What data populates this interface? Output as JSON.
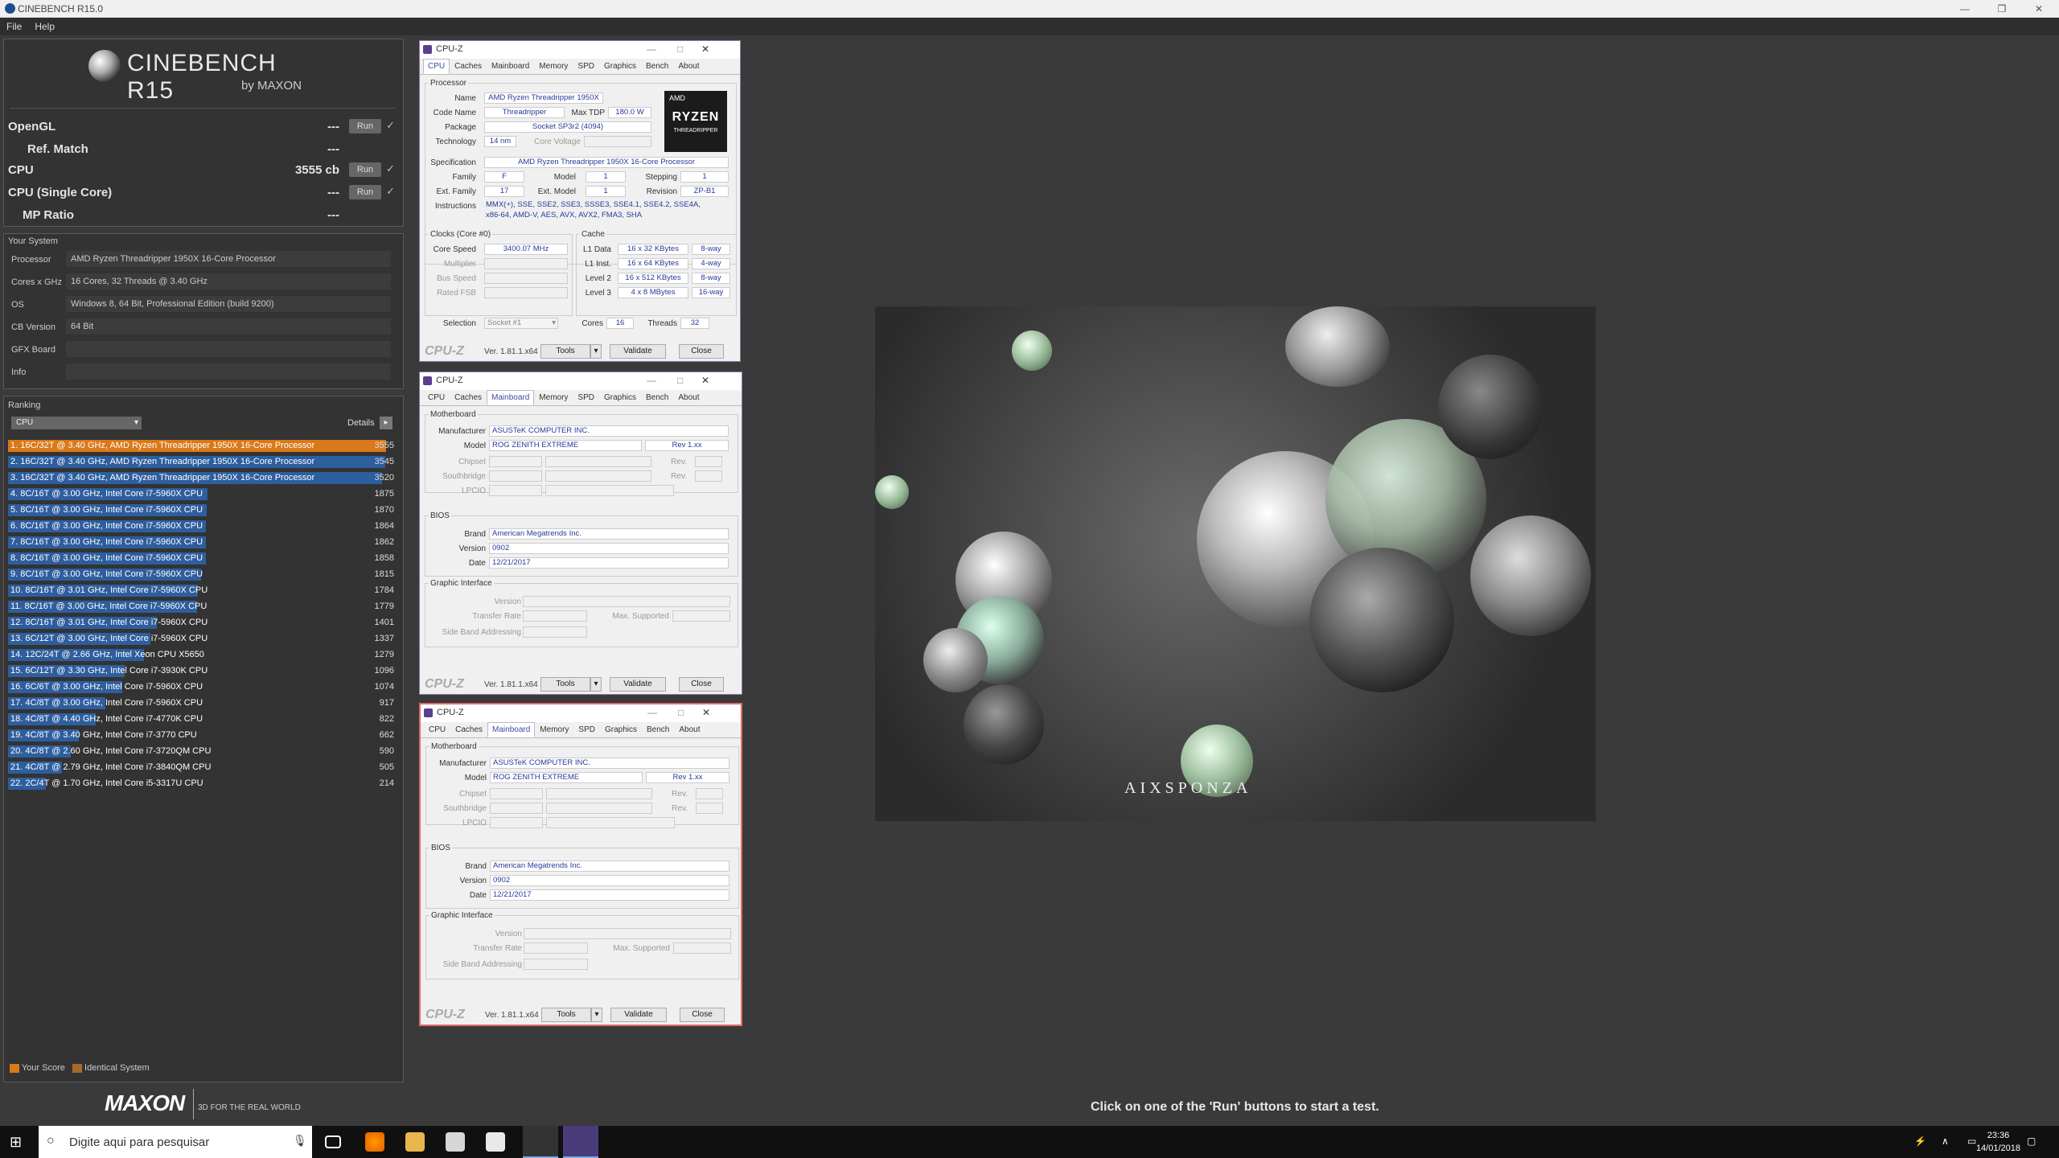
{
  "window": {
    "title": "CINEBENCH R15.0"
  },
  "menu": [
    "File",
    "Help"
  ],
  "cinebench": {
    "logo_name": "CINEBENCH R15",
    "logo_by": "by MAXON",
    "run_label": "Run",
    "benchmarks": [
      {
        "label": "OpenGL",
        "value": "---",
        "has_run": true
      },
      {
        "label": "Ref. Match",
        "value": "---",
        "has_run": false
      },
      {
        "label": "CPU",
        "value": "3555 cb",
        "has_run": true
      },
      {
        "label": "CPU (Single Core)",
        "value": "---",
        "has_run": true
      },
      {
        "label": "MP Ratio",
        "value": "---",
        "has_run": false
      }
    ],
    "your_system_title": "Your System",
    "system": [
      {
        "key": "Processor",
        "value": "AMD Ryzen Threadripper 1950X 16-Core Processor"
      },
      {
        "key": "Cores x GHz",
        "value": "16 Cores, 32 Threads @ 3.40 GHz"
      },
      {
        "key": "OS",
        "value": "Windows 8, 64 Bit, Professional Edition (build 9200)"
      },
      {
        "key": "CB Version",
        "value": "64 Bit"
      },
      {
        "key": "GFX Board",
        "value": ""
      },
      {
        "key": "Info",
        "value": ""
      }
    ],
    "ranking_title": "Ranking",
    "ranking_select": "CPU",
    "details_label": "Details",
    "ranking": [
      {
        "text": "1. 16C/32T @ 3.40 GHz, AMD Ryzen Threadripper 1950X 16-Core Processor",
        "score": 3555,
        "color": "#d9791a"
      },
      {
        "text": "2. 16C/32T @ 3.40 GHz, AMD Ryzen Threadripper 1950X 16-Core Processor",
        "score": 3545,
        "color": "#2d5e9e"
      },
      {
        "text": "3. 16C/32T @ 3.40 GHz, AMD Ryzen Threadripper 1950X 16-Core Processor",
        "score": 3520,
        "color": "#2d5e9e"
      },
      {
        "text": "4. 8C/16T @ 3.00 GHz, Intel Core i7-5960X CPU",
        "score": 1875,
        "color": "#2d5e9e"
      },
      {
        "text": "5. 8C/16T @ 3.00 GHz, Intel Core i7-5960X CPU",
        "score": 1870,
        "color": "#2d5e9e"
      },
      {
        "text": "6. 8C/16T @ 3.00 GHz, Intel Core i7-5960X CPU",
        "score": 1864,
        "color": "#2d5e9e"
      },
      {
        "text": "7. 8C/16T @ 3.00 GHz, Intel Core i7-5960X CPU",
        "score": 1862,
        "color": "#2d5e9e"
      },
      {
        "text": "8. 8C/16T @ 3.00 GHz, Intel Core i7-5960X CPU",
        "score": 1858,
        "color": "#2d5e9e"
      },
      {
        "text": "9. 8C/16T @ 3.00 GHz, Intel Core i7-5960X CPU",
        "score": 1815,
        "color": "#2d5e9e"
      },
      {
        "text": "10. 8C/16T @ 3.01 GHz, Intel Core i7-5960X CPU",
        "score": 1784,
        "color": "#2d5e9e"
      },
      {
        "text": "11. 8C/16T @ 3.00 GHz, Intel Core i7-5960X CPU",
        "score": 1779,
        "color": "#2d5e9e"
      },
      {
        "text": "12. 8C/16T @ 3.01 GHz, Intel Core i7-5960X CPU",
        "score": 1401,
        "color": "#2d5e9e"
      },
      {
        "text": "13. 6C/12T @ 3.00 GHz, Intel Core i7-5960X CPU",
        "score": 1337,
        "color": "#2d5e9e"
      },
      {
        "text": "14. 12C/24T @ 2.66 GHz, Intel Xeon CPU X5650",
        "score": 1279,
        "color": "#2d5e9e"
      },
      {
        "text": "15. 6C/12T @ 3.30 GHz,  Intel Core i7-3930K CPU",
        "score": 1096,
        "color": "#2d5e9e"
      },
      {
        "text": "16. 6C/6T @ 3.00 GHz, Intel Core i7-5960X CPU",
        "score": 1074,
        "color": "#2d5e9e"
      },
      {
        "text": "17. 4C/8T @ 3.00 GHz, Intel Core i7-5960X CPU",
        "score": 917,
        "color": "#2d5e9e"
      },
      {
        "text": "18. 4C/8T @ 4.40 GHz, Intel Core i7-4770K CPU",
        "score": 822,
        "color": "#2d5e9e"
      },
      {
        "text": "19. 4C/8T @ 3.40 GHz,  Intel Core i7-3770 CPU",
        "score": 662,
        "color": "#2d5e9e"
      },
      {
        "text": "20. 4C/8T @ 2.60 GHz, Intel Core i7-3720QM CPU",
        "score": 590,
        "color": "#2d5e9e"
      },
      {
        "text": "21. 4C/8T @ 2.79 GHz,  Intel Core i7-3840QM CPU",
        "score": 505,
        "color": "#2d5e9e"
      },
      {
        "text": "22. 2C/4T @ 1.70 GHz,  Intel Core i5-3317U CPU",
        "score": 214,
        "color": "#2d5e9e"
      }
    ],
    "legend_your_score": "Your Score",
    "legend_identical": "Identical System",
    "maxon_logo": "MAXON",
    "maxon_tagline": "3D FOR THE REAL WORLD",
    "hint": "Click on one of the 'Run' buttons to start a test."
  },
  "cpuz_common": {
    "title": "CPU-Z",
    "tabs": [
      "CPU",
      "Caches",
      "Mainboard",
      "Memory",
      "SPD",
      "Graphics",
      "Bench",
      "About"
    ],
    "logo": "CPU-Z",
    "version": "Ver. 1.81.1.x64",
    "tools": "Tools",
    "validate": "Validate",
    "close": "Close"
  },
  "cpuz_cpu": {
    "processor_group": "Processor",
    "name_label": "Name",
    "name": "AMD Ryzen Threadripper 1950X",
    "codename_label": "Code Name",
    "codename": "Threadripper",
    "maxtdp_label": "Max TDP",
    "maxtdp": "180.0 W",
    "package_label": "Package",
    "package": "Socket SP3r2 (4094)",
    "technology_label": "Technology",
    "technology": "14 nm",
    "corevoltage_label": "Core Voltage",
    "spec_label": "Specification",
    "spec": "AMD Ryzen Threadripper 1950X 16-Core Processor",
    "family_label": "Family",
    "family": "F",
    "model_label": "Model",
    "model": "1",
    "stepping_label": "Stepping",
    "stepping": "1",
    "extfamily_label": "Ext. Family",
    "extfamily": "17",
    "extmodel_label": "Ext. Model",
    "extmodel": "1",
    "revision_label": "Revision",
    "revision": "ZP-B1",
    "instructions_label": "Instructions",
    "instructions_1": "MMX(+), SSE, SSE2, SSE3, SSSE3, SSE4.1, SSE4.2, SSE4A,",
    "instructions_2": "x86-64, AMD-V, AES, AVX, AVX2, FMA3, SHA",
    "badge_top": "AMD",
    "badge_mid": "RYZEN",
    "badge_bot": "THREADRIPPER",
    "clocks_group": "Clocks (Core #0)",
    "corespeed_label": "Core Speed",
    "corespeed": "3400.07 MHz",
    "multiplier_label": "Multiplier",
    "busspeed_label": "Bus Speed",
    "ratedfsb_label": "Rated FSB",
    "cache_group": "Cache",
    "l1data_label": "L1 Data",
    "l1data": "16 x 32 KBytes",
    "l1data_way": "8-way",
    "l1inst_label": "L1 Inst.",
    "l1inst": "16 x 64 KBytes",
    "l1inst_way": "4-way",
    "l2_label": "Level 2",
    "l2": "16 x 512 KBytes",
    "l2_way": "8-way",
    "l3_label": "Level 3",
    "l3": "4 x 8 MBytes",
    "l3_way": "16-way",
    "selection_label": "Selection",
    "selection": "Socket #1",
    "cores_label": "Cores",
    "cores": "16",
    "threads_label": "Threads",
    "threads": "32"
  },
  "cpuz_mb": {
    "motherboard_group": "Motherboard",
    "manufacturer_label": "Manufacturer",
    "manufacturer": "ASUSTeK COMPUTER INC.",
    "model_label": "Model",
    "model": "ROG ZENITH EXTREME",
    "rev": "Rev 1.xx",
    "chipset_label": "Chipset",
    "southbridge_label": "Southbridge",
    "lpcio_label": "LPCIO",
    "rev_label": "Rev.",
    "bios_group": "BIOS",
    "brand_label": "Brand",
    "brand": "American Megatrends Inc.",
    "version_label": "Version",
    "version": "0902",
    "date_label": "Date",
    "date": "12/21/2017",
    "gi_group": "Graphic Interface",
    "gi_version_label": "Version",
    "gi_transfer_label": "Transfer Rate",
    "gi_max_label": "Max. Supported",
    "gi_sideband_label": "Side Band Addressing"
  },
  "render": {
    "watermark": "AIXSPONZA"
  },
  "taskbar": {
    "search_placeholder": "Digite aqui para pesquisar",
    "time": "23:36",
    "date": "14/01/2018"
  }
}
